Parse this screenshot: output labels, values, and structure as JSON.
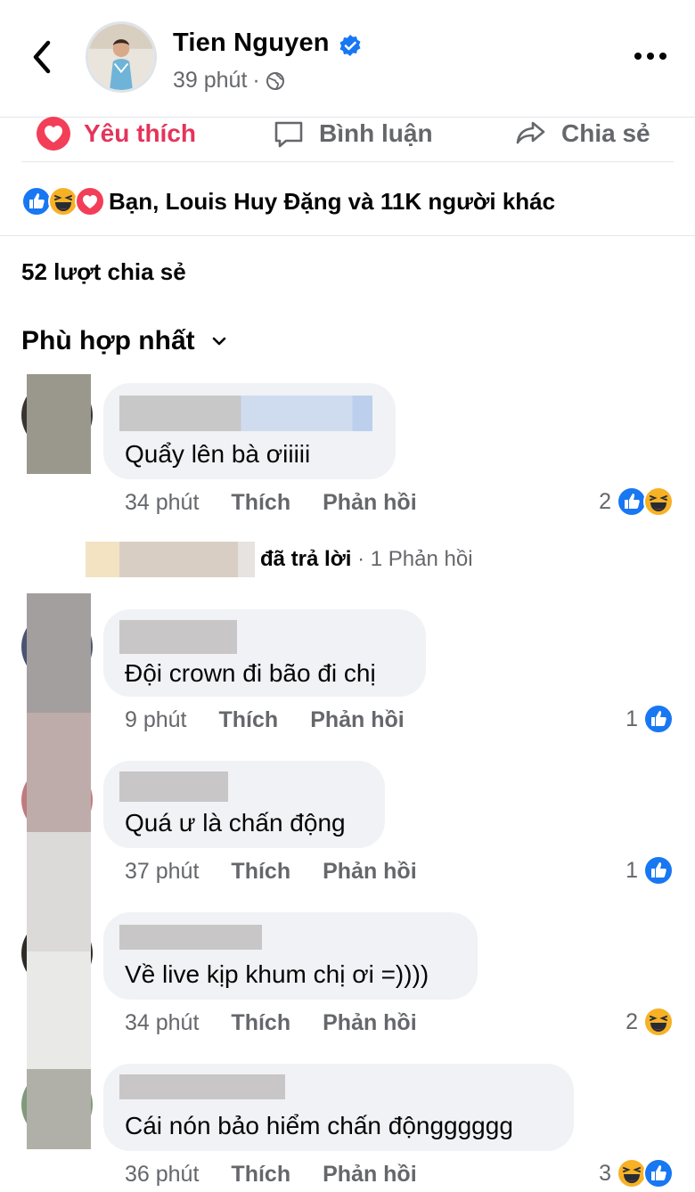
{
  "header": {
    "name": "Tien Nguyen",
    "time": "39 phút",
    "separator": "·"
  },
  "actions": {
    "like": "Yêu thích",
    "comment": "Bình luận",
    "share": "Chia sẻ"
  },
  "reactions_summary": "Bạn, Louis Huy Đặng và 11K người khác",
  "shares_count": "52 lượt chia sẻ",
  "sort_label": "Phù hợp nhất",
  "colors": {
    "blue": "#1877f2",
    "love": "#f33e58",
    "haha": "#f7b125",
    "secondary_text": "#65676b",
    "bubble": "#f0f2f5"
  },
  "comments": [
    {
      "text": "Quẩy lên bà ơiiiii",
      "time": "34 phút",
      "like": "Thích",
      "reply": "Phản hồi",
      "react_count": "2",
      "reactions": [
        "like-icon",
        "haha-icon"
      ]
    },
    {
      "text": "Đội crown đi bão đi chị",
      "time": "9 phút",
      "like": "Thích",
      "reply": "Phản hồi",
      "react_count": "1",
      "reactions": [
        "like-icon"
      ]
    },
    {
      "text": "Quá ư là chấn động",
      "time": "37 phút",
      "like": "Thích",
      "reply": "Phản hồi",
      "react_count": "1",
      "reactions": [
        "like-icon"
      ]
    },
    {
      "text": "Về live kịp khum chị ơi =))))",
      "time": "34 phút",
      "like": "Thích",
      "reply": "Phản hồi",
      "react_count": "2",
      "reactions": [
        "haha-icon"
      ]
    },
    {
      "text": "Cái nón bảo hiểm chấn độngggggg",
      "time": "36 phút",
      "like": "Thích",
      "reply": "Phản hồi",
      "react_count": "3",
      "reactions": [
        "haha-icon",
        "like-icon"
      ]
    }
  ],
  "reply_summary": {
    "text": "đã trả lời",
    "separator": "·",
    "count": "1 Phản hồi"
  }
}
